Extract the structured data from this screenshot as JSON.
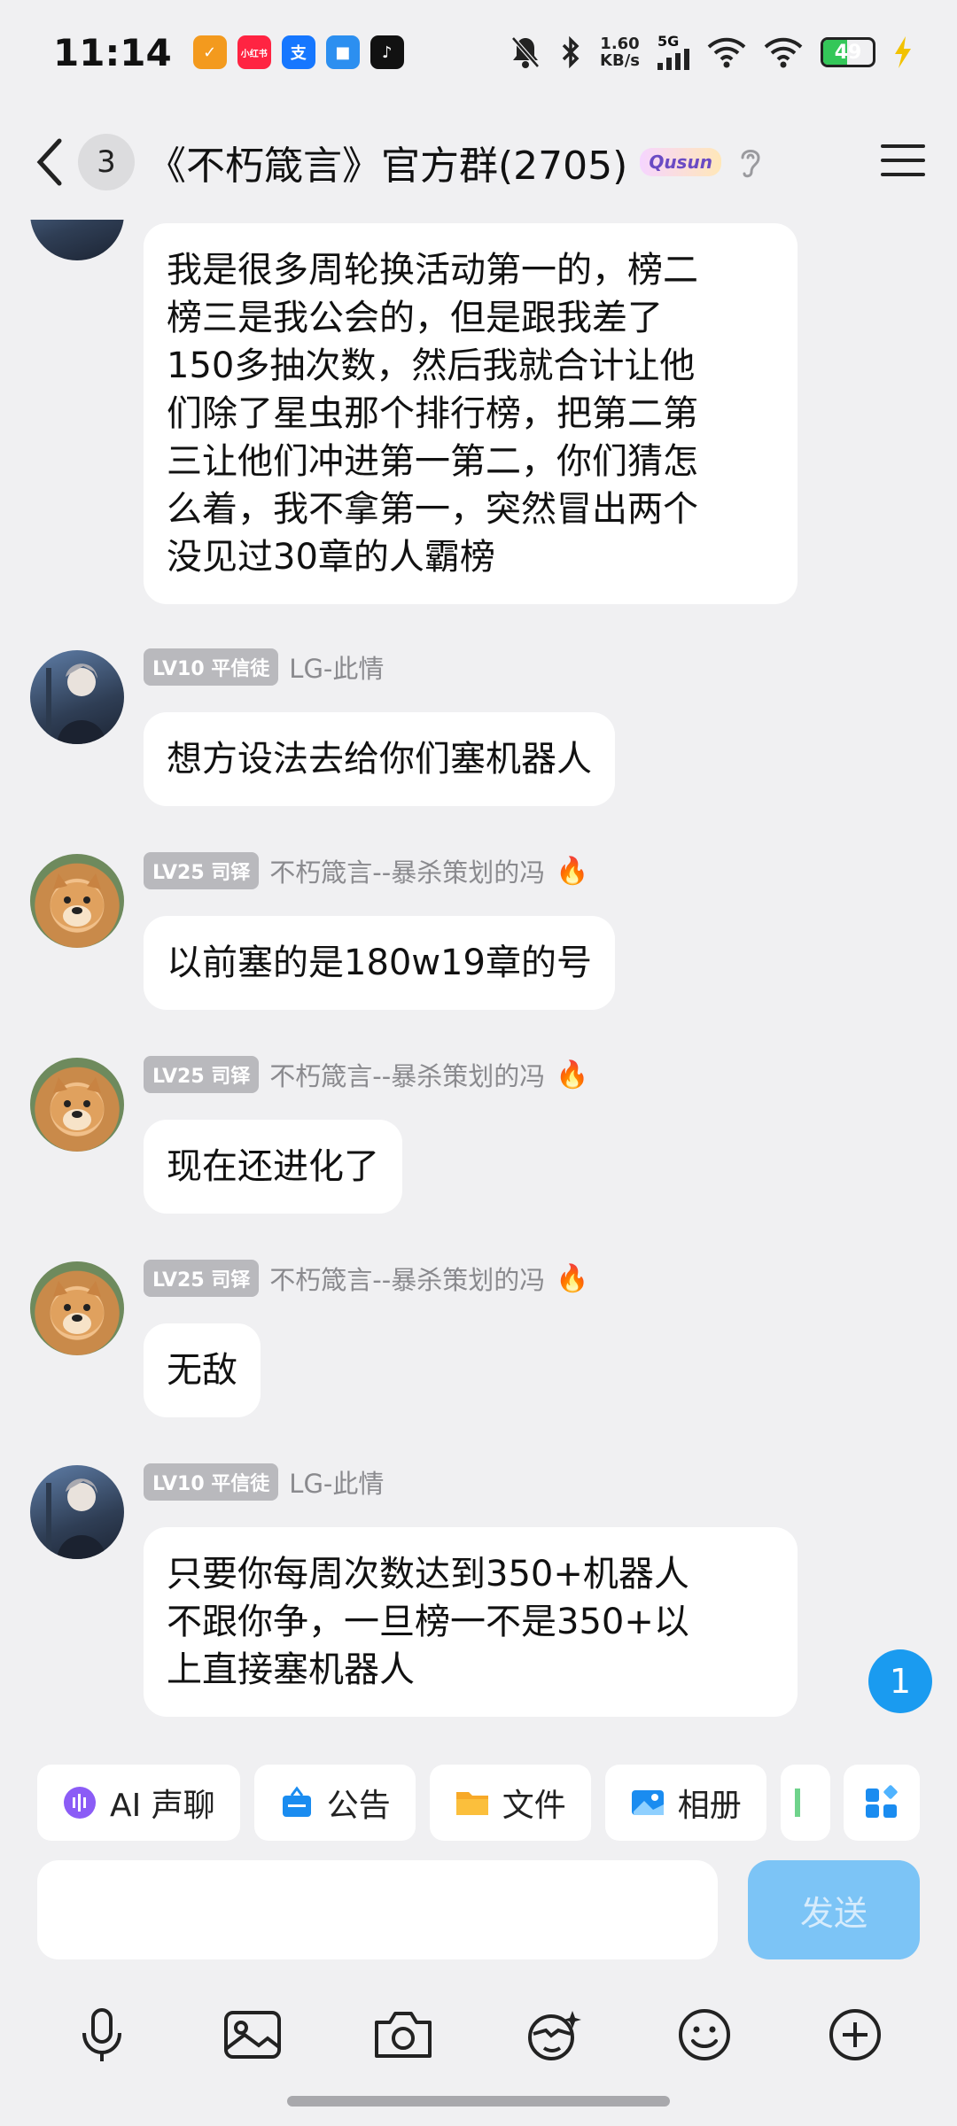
{
  "status_bar": {
    "time": "11:14",
    "app_icons": [
      {
        "name": "app-orange-icon",
        "color": "#f39a1e",
        "glyph": "✓"
      },
      {
        "name": "xiaohongshu-icon",
        "color": "#ff2442",
        "glyph": "小红书"
      },
      {
        "name": "alipay-icon",
        "color": "#1677ff",
        "glyph": "支"
      },
      {
        "name": "app-blue-icon",
        "color": "#2c8ff0",
        "glyph": "■"
      },
      {
        "name": "tiktok-icon",
        "color": "#111111",
        "glyph": "♪"
      }
    ],
    "net_speed_value": "1.60",
    "net_speed_unit": "KB/s",
    "signal_label": "5G",
    "battery_level": "49",
    "battery_fraction": 0.49
  },
  "header": {
    "unread_count": "3",
    "title": "《不朽箴言》官方群(2705)",
    "badge_text": "Qusun"
  },
  "messages": [
    {
      "avatar": "partial",
      "level": "",
      "nickname": "",
      "text": "我是很多周轮换活动第一的，榜二\n榜三是我公会的，但是跟我差了\n150多抽次数，然后我就合计让他\n们除了星虫那个排行榜，把第二第\n三让他们冲进第一第二，你们猜怎\n么着，我不拿第一，突然冒出两个\n没见过30章的人霸榜"
    },
    {
      "avatar": "anime",
      "level": "LV10 平信徒",
      "nickname": "LG-此情",
      "text": "想方设法去给你们塞机器人"
    },
    {
      "avatar": "dog",
      "level": "LV25 司铎",
      "nickname": "不朽箴言--暴杀策划的冯",
      "text": "以前塞的是180w19章的号"
    },
    {
      "avatar": "dog",
      "level": "LV25 司铎",
      "nickname": "不朽箴言--暴杀策划的冯",
      "text": "现在还进化了"
    },
    {
      "avatar": "dog",
      "level": "LV25 司铎",
      "nickname": "不朽箴言--暴杀策划的冯",
      "text": "无敌"
    },
    {
      "avatar": "anime",
      "level": "LV10 平信徒",
      "nickname": "LG-此情",
      "text": "只要你每周次数达到350+机器人\n不跟你争，一旦榜一不是350+以\n上直接塞机器人"
    }
  ],
  "new_message_count": "1",
  "quick_actions": [
    {
      "label": "AI 声聊",
      "icon": "ai-voice-icon"
    },
    {
      "label": "公告",
      "icon": "announcement-icon"
    },
    {
      "label": "文件",
      "icon": "folder-icon"
    },
    {
      "label": "相册",
      "icon": "album-icon"
    }
  ],
  "input": {
    "placeholder": "",
    "send_label": "发送"
  },
  "bottom_icons": [
    "microphone-icon",
    "image-icon",
    "camera-icon",
    "face-effect-icon",
    "emoji-icon",
    "plus-icon"
  ],
  "colors": {
    "background": "#f0f0f2",
    "accent": "#1a9bf0",
    "send_disabled": "#7cc4f6",
    "level_badge": "#b9b9bd"
  }
}
